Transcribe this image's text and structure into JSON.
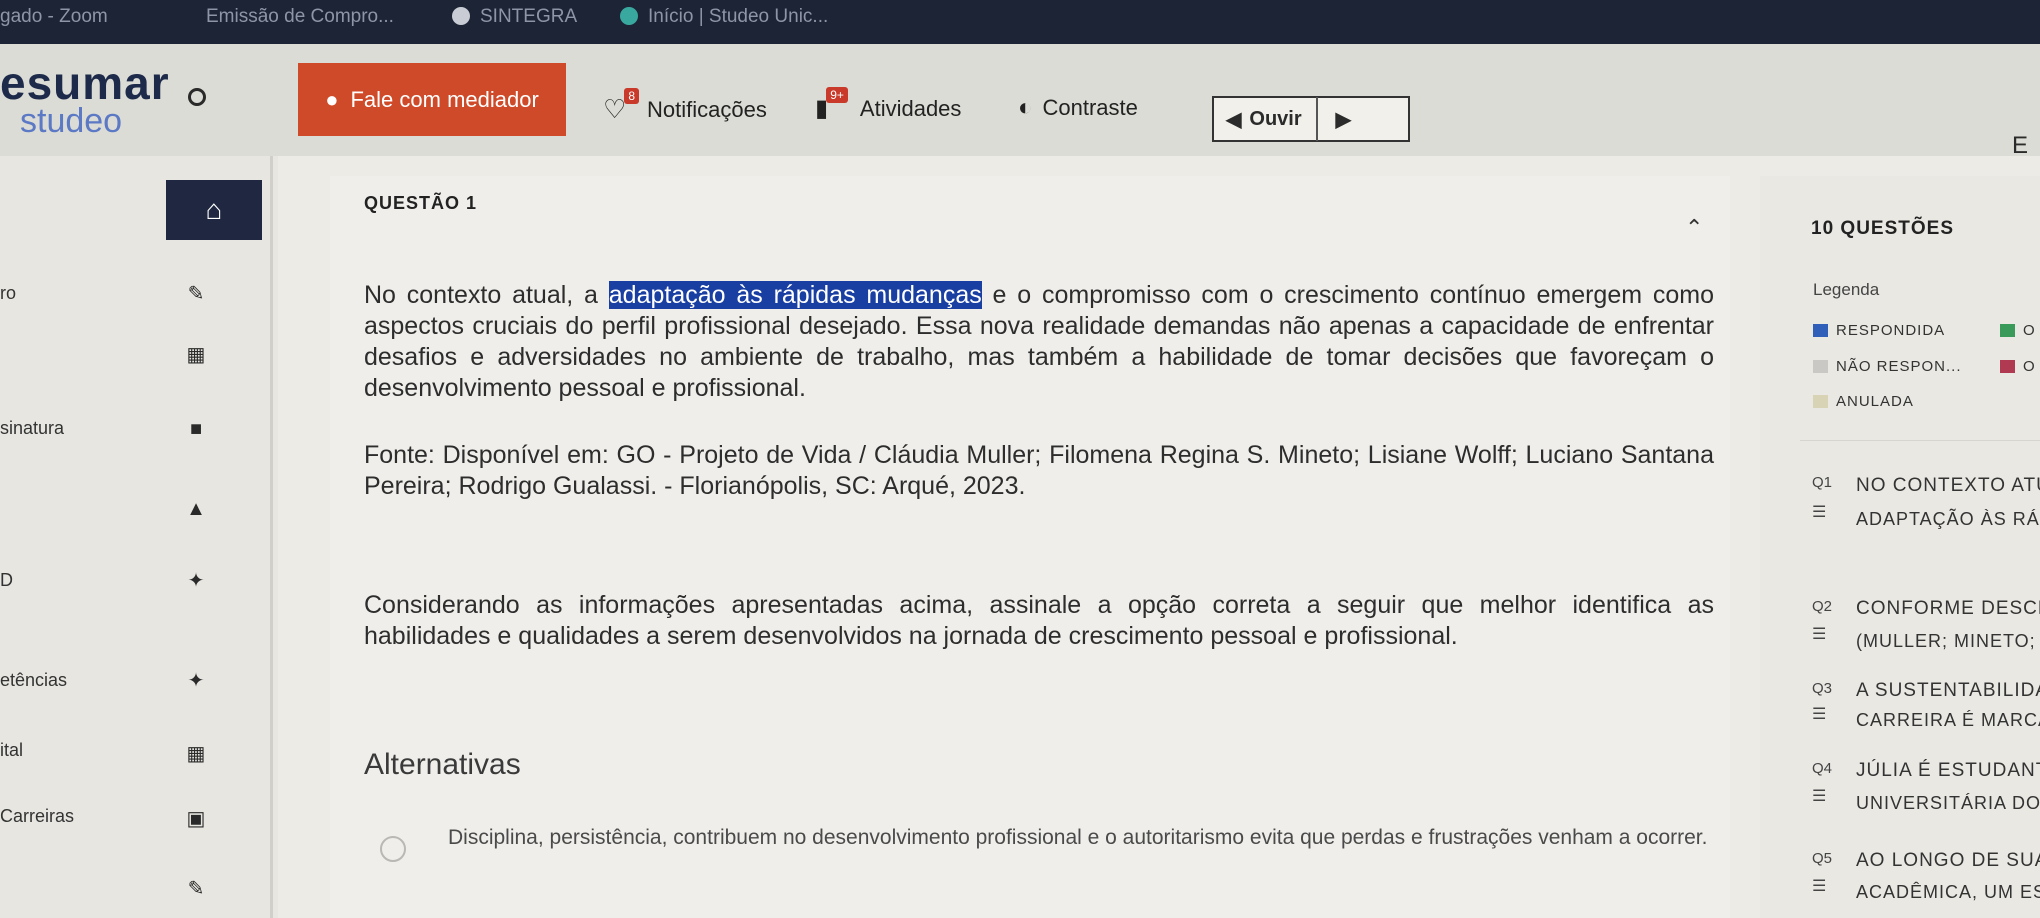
{
  "browser_tabs": [
    {
      "label": "gado - Zoom"
    },
    {
      "label": "Emissão de Compro..."
    },
    {
      "label": "SINTEGRA"
    },
    {
      "label": "Início | Studeo Unic..."
    }
  ],
  "header": {
    "brand_top": "esumar",
    "brand_bottom": "studeo",
    "mediator_label": "Fale com mediador",
    "notifications_label": "Notificações",
    "notifications_badge": "8",
    "activities_label": "Atividades",
    "activities_badge": "9+",
    "contrast_label": "Contraste",
    "listen_label": "Ouvir",
    "edge_letter": "E"
  },
  "sidebar": {
    "items": [
      {
        "label": "ro",
        "icon": "pencil-icon"
      },
      {
        "label": "",
        "icon": "calendar-icon"
      },
      {
        "label": "sinatura",
        "icon": "book-icon"
      },
      {
        "label": "",
        "icon": "graduation-cap-icon"
      },
      {
        "label": "D",
        "icon": "puzzle-icon"
      },
      {
        "label": "etências",
        "icon": "puzzle-icon"
      },
      {
        "label": "ital",
        "icon": "calendar-icon"
      },
      {
        "label": "Carreiras",
        "icon": "briefcase-icon"
      },
      {
        "label": "",
        "icon": "pencil-icon"
      }
    ]
  },
  "question": {
    "heading": "QUESTÃO 1",
    "p1_before": "No contexto atual, a ",
    "p1_highlight": "adaptação às rápidas mudanças",
    "p1_after": " e o compromisso com o crescimento contínuo emergem como aspectos cruciais do perfil profissional desejado. Essa nova realidade demandas não apenas a capacidade de enfrentar desafios e adversidades no ambiente de trabalho, mas também a habilidade de tomar decisões que favoreçam o desenvolvimento pessoal e profissional.",
    "source": "Fonte: Disponível em: GO - Projeto de Vida / Cláudia Muller; Filomena Regina S. Mineto; Lisiane Wolff; Luciano Santana Pereira; Rodrigo Gualassi. - Florianópolis, SC: Arqué, 2023.",
    "prompt": "Considerando as informações apresentadas acima, assinale a opção correta a seguir que melhor identifica as habilidades e qualidades a serem desenvolvidos na jornada de crescimento pessoal e profissional.",
    "alternatives_heading": "Alternativas",
    "alternatives": [
      {
        "text": "Disciplina, persistência, contribuem no desenvolvimento profissional e o autoritarismo evita que perdas e frustrações venham a ocorrer."
      }
    ]
  },
  "right_panel": {
    "count_label": "10 QUESTÕES",
    "legend_title": "Legenda",
    "legend": [
      {
        "label": "RESPONDIDA",
        "color": "#2f5fb8"
      },
      {
        "label": "NÃO RESPON...",
        "color": "#c9c8c4"
      },
      {
        "label": "ANULADA",
        "color": "#d9d3b6"
      }
    ],
    "legend_right": [
      {
        "label": "O",
        "color": "#3a9a5a"
      },
      {
        "label": "O",
        "color": "#b03a52"
      }
    ],
    "questions": [
      {
        "num": "Q1",
        "line1": "NO CONTEXTO ATUA",
        "line2": "ADAPTAÇÃO ÀS RÁPI"
      },
      {
        "num": "Q2",
        "line1": "CONFORME DESCRIT",
        "line2": "(MULLER; MINETO; W"
      },
      {
        "num": "Q3",
        "line1": "A SUSTENTABILIDADE",
        "line2": "CARREIRA É MARCAD"
      },
      {
        "num": "Q4",
        "line1": "JÚLIA É ESTUDANTE",
        "line2": "UNIVERSITÁRIA DO PR"
      },
      {
        "num": "Q5",
        "line1": "AO LONGO DE SUA TR",
        "line2": "ACADÊMICA, UM ESTU"
      }
    ]
  }
}
